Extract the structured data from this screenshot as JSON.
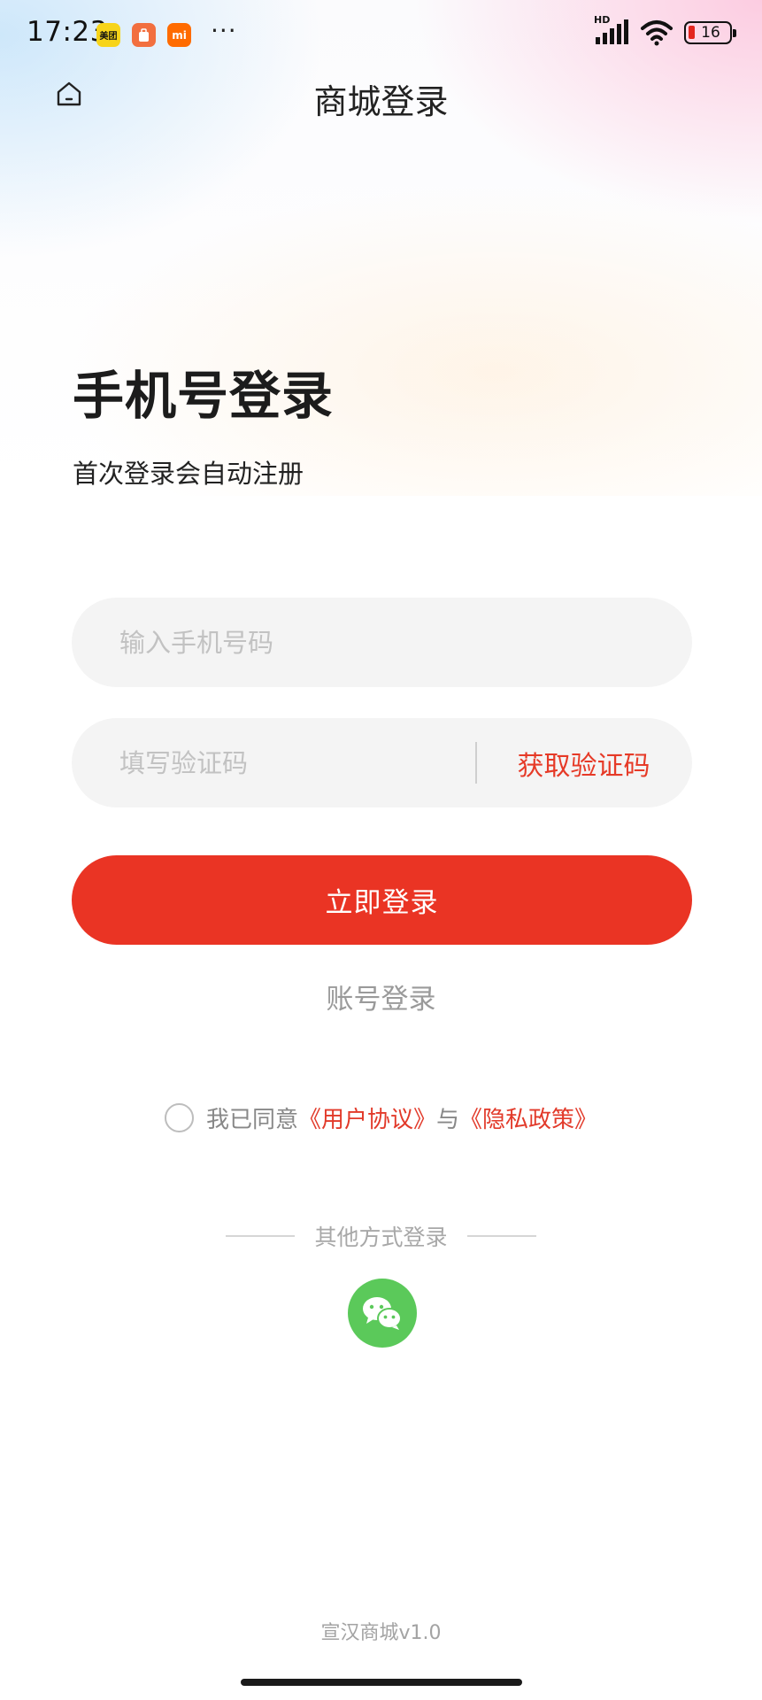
{
  "status_bar": {
    "time": "17:23",
    "app_icons": [
      "美团",
      "",
      "mi"
    ],
    "more": "···",
    "network": "HD",
    "battery": "16"
  },
  "nav": {
    "home_icon": "home-icon",
    "title": "商城登录"
  },
  "page": {
    "heading": "手机号登录",
    "subtitle": "首次登录会自动注册"
  },
  "form": {
    "phone_placeholder": "输入手机号码",
    "code_placeholder": "填写验证码",
    "get_code_label": "获取验证码",
    "login_label": "立即登录",
    "account_login_label": "账号登录"
  },
  "agreement": {
    "prefix": "我已同意",
    "user_agreement": "《用户协议》",
    "conjunction": "与",
    "privacy_policy": "《隐私政策》",
    "checked": false
  },
  "other_login": {
    "label": "其他方式登录",
    "methods": [
      "wechat-icon"
    ]
  },
  "footer": {
    "version": "宣汉商城v1.0"
  },
  "colors": {
    "accent": "#ea3424",
    "link": "#e23a2a",
    "wechat": "#5bc95a",
    "input_bg": "#f4f4f4"
  }
}
